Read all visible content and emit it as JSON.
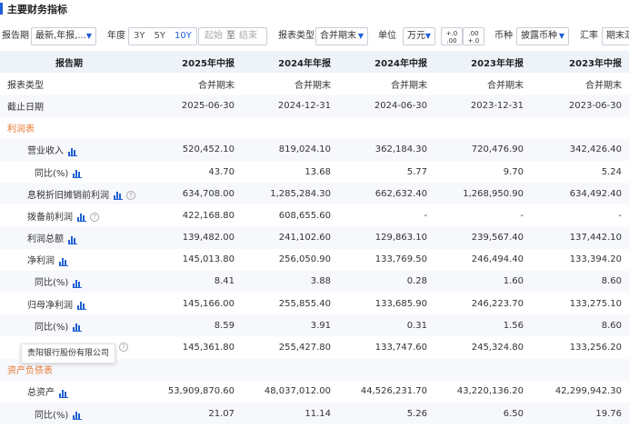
{
  "title": "主要财务指标",
  "toolbar": {
    "report_period_label": "报告期",
    "report_period_value": "最新,年报,...",
    "year_label": "年度",
    "year_options": [
      "3Y",
      "5Y",
      "10Y"
    ],
    "year_selected": "10Y",
    "start_label": "起始",
    "to_label": "至",
    "end_label": "结束",
    "report_type_label": "报表类型",
    "report_type_value": "合并期末",
    "unit_label": "单位",
    "unit_value": "万元",
    "dec_increase_top": "+.0",
    "dec_increase_bottom": ".00",
    "dec_decrease_top": ".00",
    "dec_decrease_bottom": "+.0",
    "currency_label": "币种",
    "currency_value": "披露币种",
    "rate_label": "汇率",
    "rate_value": "期末汇"
  },
  "table": {
    "header_label": "报告期",
    "columns": [
      "2025年中报",
      "2024年年报",
      "2024年中报",
      "2023年年报",
      "2023年中报"
    ],
    "rows": [
      {
        "label": "报表类型",
        "values": [
          "合并期末",
          "合并期末",
          "合并期末",
          "合并期末",
          "合并期末"
        ]
      },
      {
        "label": "截止日期",
        "values": [
          "2025-06-30",
          "2024-12-31",
          "2024-06-30",
          "2023-12-31",
          "2023-06-30"
        ]
      },
      {
        "label": "利润表",
        "values": [
          "",
          "",
          "",
          "",
          ""
        ]
      },
      {
        "label": "营业收入",
        "values": [
          "520,452.10",
          "819,024.10",
          "362,184.30",
          "720,476.90",
          "342,426.40"
        ]
      },
      {
        "label": "同比(%)",
        "values": [
          "43.70",
          "13.68",
          "5.77",
          "9.70",
          "5.24"
        ]
      },
      {
        "label": "息税折旧摊销前利润",
        "values": [
          "634,708.00",
          "1,285,284.30",
          "662,632.40",
          "1,268,950.90",
          "634,492.40"
        ]
      },
      {
        "label": "拨备前利润",
        "values": [
          "422,168.80",
          "608,655.60",
          "-",
          "-",
          "-"
        ]
      },
      {
        "label": "利润总额",
        "values": [
          "139,482.00",
          "241,102.60",
          "129,863.10",
          "239,567.40",
          "137,442.10"
        ]
      },
      {
        "label": "净利润",
        "values": [
          "145,013.80",
          "256,050.90",
          "133,769.50",
          "246,494.40",
          "133,394.20"
        ]
      },
      {
        "label": "同比(%)",
        "values": [
          "8.41",
          "3.88",
          "0.28",
          "1.60",
          "8.60"
        ]
      },
      {
        "label": "归母净利润",
        "values": [
          "145,166.00",
          "255,855.40",
          "133,685.90",
          "246,223.70",
          "133,275.10"
        ]
      },
      {
        "label": "同比(%)",
        "values": [
          "8.59",
          "3.91",
          "0.31",
          "1.56",
          "8.60"
        ]
      },
      {
        "label": "",
        "values": [
          "145,361.80",
          "255,427.80",
          "133,747.60",
          "245,324.80",
          "133,256.20"
        ]
      },
      {
        "label": "资产负债表",
        "values": [
          "",
          "",
          "",
          "",
          ""
        ]
      },
      {
        "label": "总资产",
        "values": [
          "53,909,870.60",
          "48,037,012.00",
          "44,526,231.70",
          "43,220,136.20",
          "42,299,942.30"
        ]
      },
      {
        "label": "同比(%)",
        "values": [
          "21.07",
          "11.14",
          "5.26",
          "6.50",
          "19.76"
        ]
      }
    ]
  },
  "tooltip_text": "贵阳银行股份有限公司",
  "colors": {
    "accent": "#1f5fd6",
    "section": "#e8772e",
    "header_bg": "#eef2f9",
    "stripe_bg": "#f6f8fc"
  }
}
